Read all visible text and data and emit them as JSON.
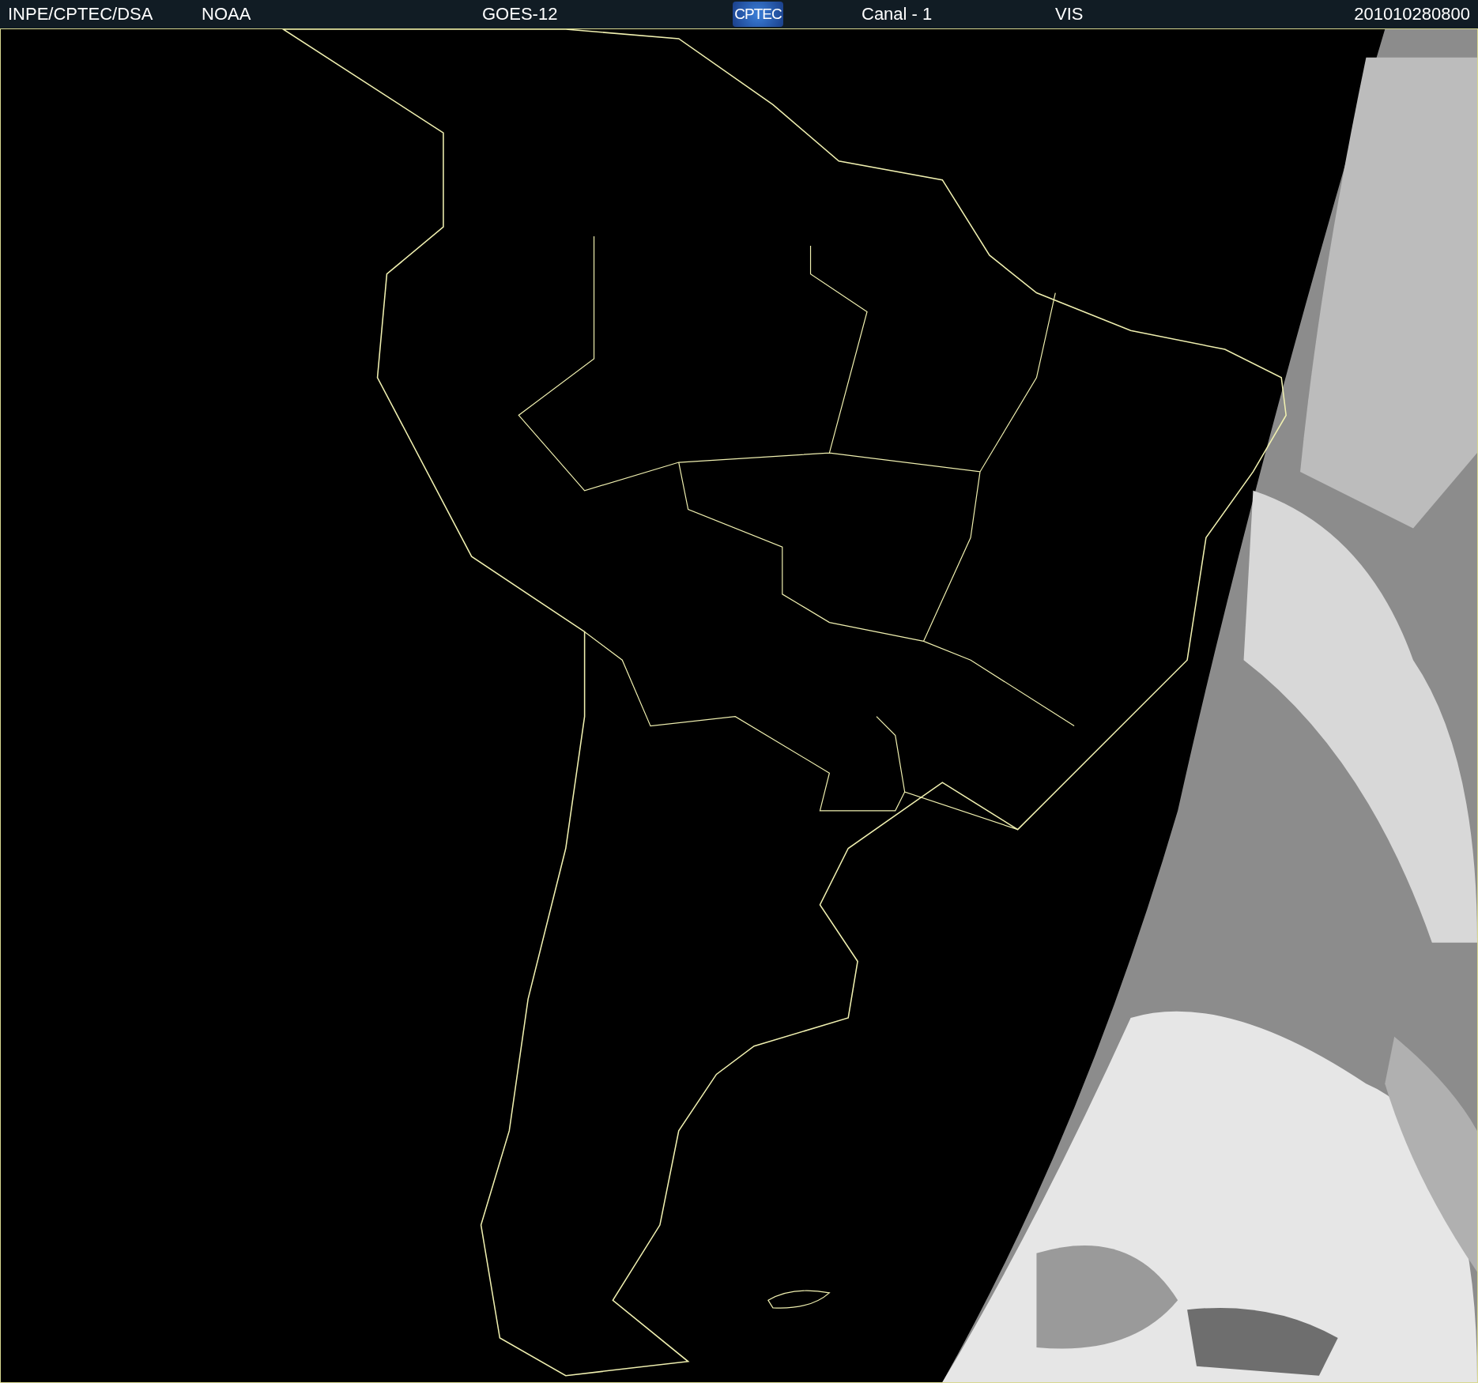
{
  "header": {
    "items": [
      {
        "kind": "text",
        "text": "INPE/CPTEC/DSA"
      },
      {
        "kind": "text",
        "text": "NOAA"
      },
      {
        "kind": "text",
        "text": "GOES-12"
      },
      {
        "kind": "logo",
        "text": "CPTEC"
      },
      {
        "kind": "text",
        "text": "Canal - 1"
      },
      {
        "kind": "text",
        "text": "VIS"
      },
      {
        "kind": "text",
        "text": "201010280800"
      }
    ]
  }
}
